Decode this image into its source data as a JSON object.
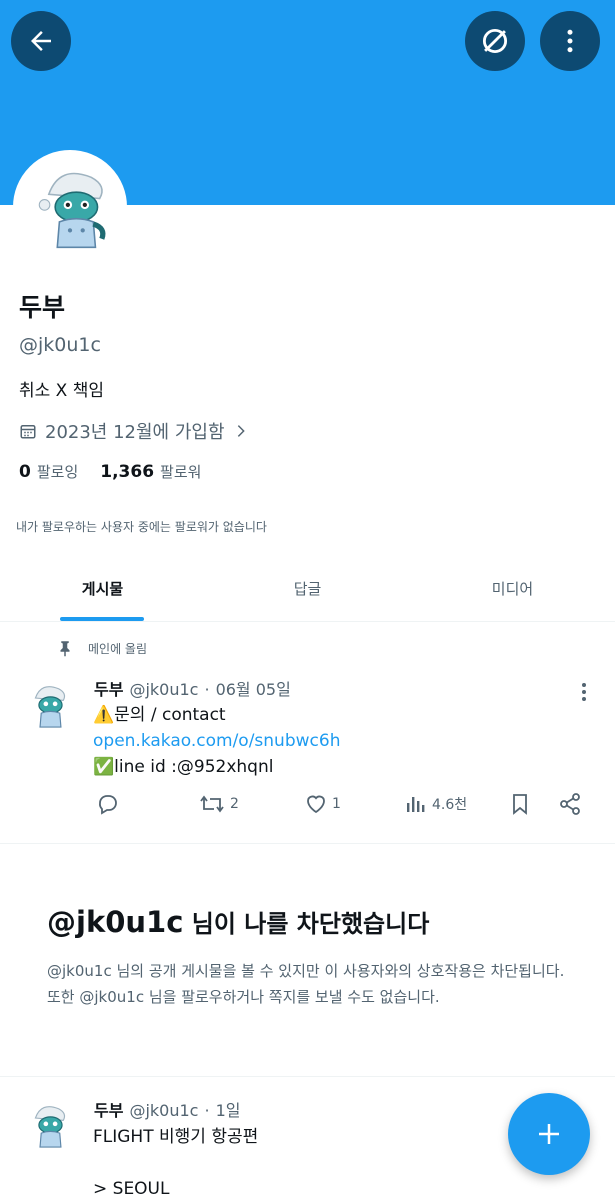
{
  "profile": {
    "name": "두부",
    "handle": "@jk0u1c",
    "bio": "취소 X 책임",
    "joined": "2023년 12월에 가입함",
    "following_count": "0",
    "following_label": "팔로잉",
    "followers_count": "1,366",
    "followers_label": "팔로워",
    "followers_note": "내가 팔로우하는 사용자 중에는 팔로워가 없습니다"
  },
  "tabs": [
    {
      "label": "게시물",
      "active": true
    },
    {
      "label": "답글",
      "active": false
    },
    {
      "label": "미디어",
      "active": false
    }
  ],
  "pinned_label": "메인에 올림",
  "tweets": [
    {
      "name": "두부",
      "handle": "@jk0u1c",
      "sep": "·",
      "time": "06월 05일",
      "line1": "⚠️문의 / contact",
      "link": "open.kakao.com/o/snubwc6h",
      "line3": "✅line id :@952xhqnl",
      "retweets": "2",
      "likes": "1",
      "views": "4.6천"
    },
    {
      "name": "두부",
      "handle": "@jk0u1c",
      "sep": "·",
      "time": "1일",
      "line1": "FLIGHT 비행기 항공편",
      "line2": "> SEOUL"
    }
  ],
  "blocked": {
    "handle": "@jk0u1c",
    "title_suffix": " 님이 나를 차단했습니다",
    "description": "@jk0u1c 님의 공개 게시물을 볼 수 있지만 이 사용자와의 상호작용은 차단됩니다. 또한 @jk0u1c 님을 팔로우하거나 쪽지를 보낼 수도 없습니다."
  },
  "colors": {
    "accent": "#1d9bf0",
    "banner": "#1d9bf0",
    "dark_button": "#0d4a72",
    "muted_text": "#536471"
  },
  "icons": [
    "back-arrow-icon",
    "grok-icon",
    "more-vertical-icon",
    "calendar-icon",
    "chevron-right-icon",
    "pin-icon",
    "reply-icon",
    "retweet-icon",
    "like-icon",
    "views-icon",
    "bookmark-icon",
    "share-icon",
    "plus-icon"
  ]
}
